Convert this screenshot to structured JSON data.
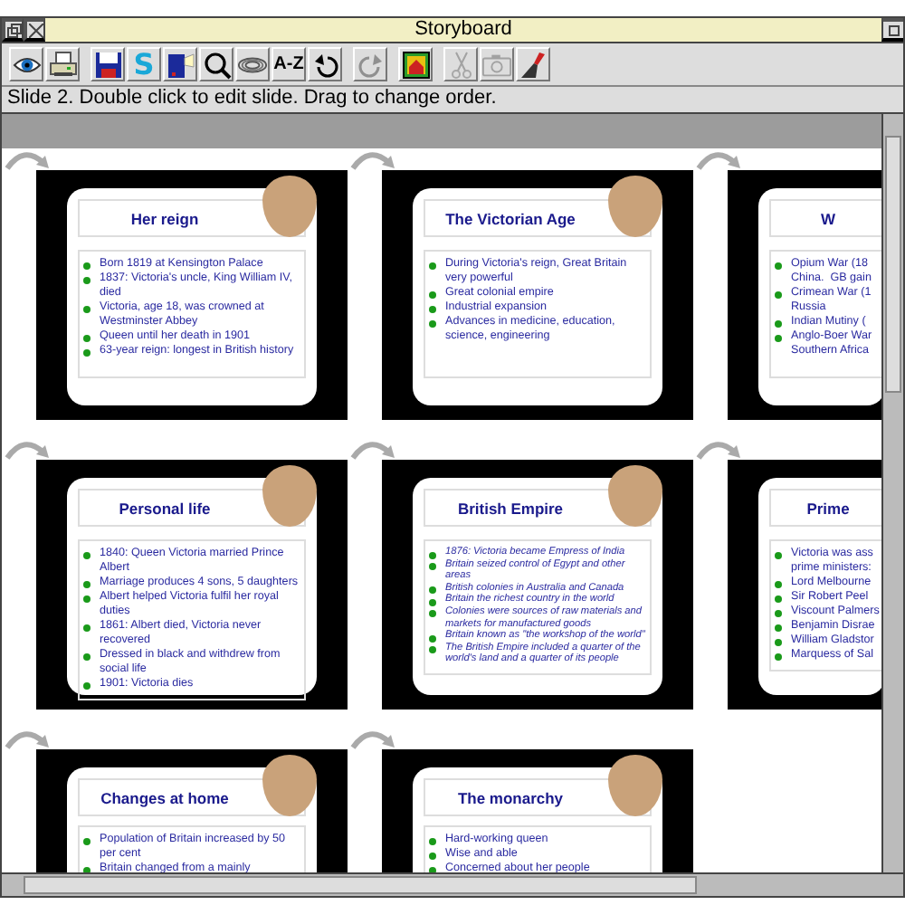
{
  "window": {
    "title": "Storyboard"
  },
  "toolbar": [
    {
      "disabled": false
    },
    {
      "disabled": false
    },
    {
      "disabled": false
    },
    {
      "label": "S",
      "disabled": false
    },
    {
      "disabled": false
    },
    {
      "disabled": false
    },
    {
      "disabled": false
    },
    {
      "label": "A-Z",
      "disabled": false
    },
    {
      "disabled": false
    },
    {
      "disabled": true
    },
    {
      "disabled": false
    },
    {
      "disabled": true
    },
    {
      "disabled": true
    },
    {
      "disabled": false
    }
  ],
  "status": "Slide 2. Double click to edit slide. Drag to change order.",
  "slides": [
    {
      "title": "Her reign",
      "italic": false,
      "bullets": [
        "Born 1819 at Kensington Palace",
        "1837: Victoria's uncle, King William IV, died",
        "Victoria, age 18, was crowned at Westminster Abbey",
        "Queen until her death in 1901",
        "63-year reign: longest in British history"
      ]
    },
    {
      "title": "The Victorian Age",
      "italic": false,
      "bullets": [
        "During Victoria's reign, Great Britain very powerful",
        "Great colonial empire",
        "Industrial expansion",
        "Advances in medicine, education, science, engineering"
      ]
    },
    {
      "title": "W",
      "italic": false,
      "bullets": [
        "Opium War (18\nChina.  GB gain",
        "Crimean War (1\nRussia",
        "Indian Mutiny (",
        "Anglo-Boer War\nSouthern Africa"
      ]
    },
    {
      "title": "Personal life",
      "italic": false,
      "bullets": [
        "1840: Queen Victoria married Prince Albert",
        "Marriage produces 4 sons, 5 daughters",
        "Albert helped Victoria fulfil her royal duties",
        "1861: Albert died, Victoria never recovered",
        "Dressed in black and withdrew from social life",
        "1901: Victoria dies"
      ]
    },
    {
      "title": "British Empire",
      "italic": true,
      "bullets": [
        "1876: Victoria became Empress of India",
        "Britain seized control of Egypt and other areas",
        "British colonies in Australia and Canada",
        "Britain the richest country in the world",
        "Colonies were sources of raw materials and markets for manufactured goods",
        "Britain known as \"the workshop of the world\"",
        "The British Empire included a quarter of the world's land and a quarter of its people"
      ]
    },
    {
      "title": "Prime",
      "italic": false,
      "bullets": [
        "Victoria was ass\nprime ministers:",
        "Lord Melbourne",
        "Sir Robert Peel",
        "Viscount Palmers",
        "Benjamin Disrae",
        "William Gladstor",
        "Marquess of Sal"
      ]
    },
    {
      "title": "Changes at home",
      "italic": false,
      "bullets": [
        "Population of Britain increased by 50 per cent",
        "Britain changed from a mainly"
      ]
    },
    {
      "title": "The monarchy",
      "italic": false,
      "bullets": [
        "Hard-working queen",
        "Wise and able",
        "Concerned about her people"
      ]
    }
  ]
}
